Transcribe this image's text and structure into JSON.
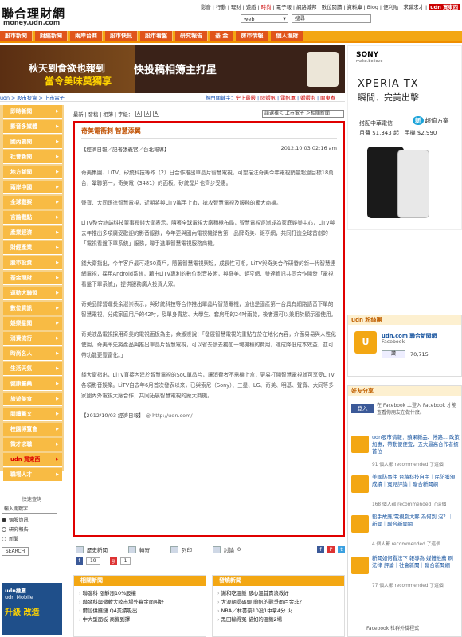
{
  "header": {
    "logo_title": "聯合理財網",
    "logo_domain": "money.udn.com",
    "links": [
      "影音",
      "行動",
      "理財",
      "遊戲",
      "時尚",
      "電子報",
      "網路城邦",
      "數位閱讀",
      "資料庫",
      "Blog",
      "便利貼",
      "求職求才"
    ],
    "highlight_link": "時尚",
    "udn_buy": "udn 買東西",
    "search_select": "web",
    "search_value": "搜尋"
  },
  "nav": [
    "股市新聞",
    "財經新聞",
    "兩岸台商",
    "股市快訊",
    "股市看盤",
    "研究報告",
    "基  金",
    "房市情報",
    "個人理財"
  ],
  "banner": {
    "line1": "秋天到食欲也報到",
    "line2": "當令美味莫獨享",
    "line3": "快投稿相簿主打星"
  },
  "breadcrumb": "udn > 股市投資 > 上市電子",
  "related_links": [
    "熱門關鍵字：",
    "史上最嚴",
    "陸蝦帆",
    "雷帆軍",
    "蝦蝦泡",
    "關東煮"
  ],
  "sidebar": [
    "即時新聞",
    "影音多媒體",
    "國內要聞",
    "社會新聞",
    "地方新聞",
    "兩岸中國",
    "全球觀察",
    "言論觀點",
    "產業經濟",
    "財經產業",
    "股市投資",
    "基金理財",
    "運動大聯盟",
    "數位資訊",
    "娛樂星聞",
    "消費流行",
    "時尚名人",
    "生活天氣",
    "健康醫藥",
    "旅遊美食",
    "閱讀藝文",
    "校園博覽會",
    "徵才求職",
    "udn 買東西",
    "職場人才"
  ],
  "sidebar_red_index": 23,
  "tools": {
    "labels": "最新 | 發稿 | 相簿 | 字級：",
    "select": "請選擇＜ 上市電子 ＞相關新聞"
  },
  "article": {
    "headline": "奇美電衝刺 智慧添翼",
    "byline": "【經濟日報／記者張義宮／台北報導】",
    "datetime": "2012.10.03 02:16 am",
    "paragraphs": [
      "奇美集團、LiTV、矽統科技等昨（2）日合作推出單晶片智慧電視，可望挹注奇美今年電視銷量超過目標18萬台，鞏聯第一，奇美電（3481）的面板、矽統晶片也齊步受惠。",
      "聲寶、大同跟進智慧電視，近期將與LiTV攜手上市，搶攻智慧電視及服務的龐大商機。",
      "LiTV整合終端科技董事長錢大衛表示，隨著全球電視大廠積極布局，智慧電視逐漸成為家庭娛樂中心，LiTV與去年推出多項廣受歡迎的影音服務，今年更與國內電視機銷售第一品牌奇美、鉅亨網，共同打造全球首創的「電視看盤下單系統」服務，聯手進軍智慧電視服務商機。",
      "錢大衛指出，今年客戶最可達50萬戶，隨著智慧電視興起，成長性可期，LiTV與奇美合作研發的新一代智慧連網電視，採用Android系統，藉由LiTV專利的數位影音技術，與奇美、鉅亨網、雙達資訊共同合作開發「電視看盤下單系統」，提供服務廣大投資大眾。",
      "奇美品牌營運長余淑崇表示，與矽統科技等合作推出單晶片智慧電視，這也是國產第一台具有網路語音下單的智慧電視，分成家庭用戶的42吋，及單身貴族、大學生、套房用的24吋兩款，後者還可以兼用於顯示器使用。",
      "奇美液晶電視採用奇美的電視面板為主，余淑崇說：「發展智慧電視的重點在於在地化內容，介面易易與人性化使用，奇美率先將產品與推出單晶片智慧電視，可以省去讀去獨加一塊機種的費用，達成降低成本效益，並可帶功能更豐富化。」",
      "錢大衛指出，LiTV直接內建於智慧電視的SoC單晶片，讓消費者不需機上盒，更易打開智慧電視就可享受LiTV各項影音娛樂。LiTV自去年6月首次發表以來，已與索尼（Sony）、三星、LG、奇美、明基、聲寶、大同等多家國內外電視大廠合作，共同拓展智慧電視的龐大商機。"
    ],
    "source": "【2012/10/03 經濟日報】",
    "source_url": "@ http://udn.com/"
  },
  "share": {
    "items": [
      "歷史新聞",
      "轉寄",
      "列印",
      "討論",
      "0"
    ],
    "counts": [
      "19",
      "1"
    ]
  },
  "ad": {
    "brand": "SONY",
    "brand_sub": "make.believe",
    "product": "XPERIA TX",
    "slogan": "瞬間．完美出擊",
    "carrier": "搭配中華電信",
    "plan": "超值方案",
    "price_month": "月費 $1,343 起",
    "price_phone": "手機 $2,990"
  },
  "fans": {
    "title": "udn 粉絲團",
    "name": "udn.com 聯合新聞網",
    "platform": "Facebook",
    "like": "讚",
    "like_count": "70,715"
  },
  "friends": {
    "title": "好友分享",
    "login": "登入",
    "login_text": "在 Facebook 上登入 Facebook 才能查看你朋友在做什麼。",
    "items": [
      {
        "text": "udn股市情報：蘋果新品、停路... 政策加惠，帶動便便宜，五大最高合作者擔首位",
        "meta": "91 個人都 recommended 了這個"
      },
      {
        "text": "美國防事件 台積科技自主｜民防獲頒成績｜寬見評論｜聯合新聞網",
        "meta": "168 個人都 recommended 了這個"
      },
      {
        "text": "殺手故應/電視劇大夥 為何到 沒？｜ 新聞｜聯合新聞網",
        "meta": "4 個人都 recommended 了這個"
      },
      {
        "text": "新聞如何看法下 報導為 媒體推薦 刷 法律 評論｜社會新聞｜聯合新聞網",
        "meta": "77 個人都 recommended 了這個"
      }
    ],
    "plugin": "Facebook 社群外掛程式"
  },
  "related": {
    "left_title": "相關新聞",
    "right_title": "發燒新聞",
    "left": [
      "聯發科 漲靜漲10%股權",
      "聯發科與微軟大陸市場外資金面叫好",
      "爾認供應鏈 Q4業績吸出",
      "中大型面板 商機到擇"
    ],
    "right": [
      "謝和吃溫飯 駭心溫首賣浪教好",
      "大浪朝提碼頭 蘭帆的戰爭面百金非？",
      "NBA／林書豪10投1中拿4分 火...",
      "黑田輸得冤 貓如的溫飽2場"
    ]
  },
  "quick": {
    "title": "快速查詢",
    "placeholder": "輸入關鍵字",
    "options": [
      "個股資訊",
      "研究報告",
      "新聞"
    ],
    "button": "SEARCH"
  },
  "udnad": {
    "title": "udn推薦",
    "line": "udn Mobile",
    "big": "升級 改造"
  },
  "colors": {
    "nav_bg": "#f3a713",
    "nav_item": "#e0541b",
    "article_border": "#e00000",
    "headline": "#c05000"
  }
}
